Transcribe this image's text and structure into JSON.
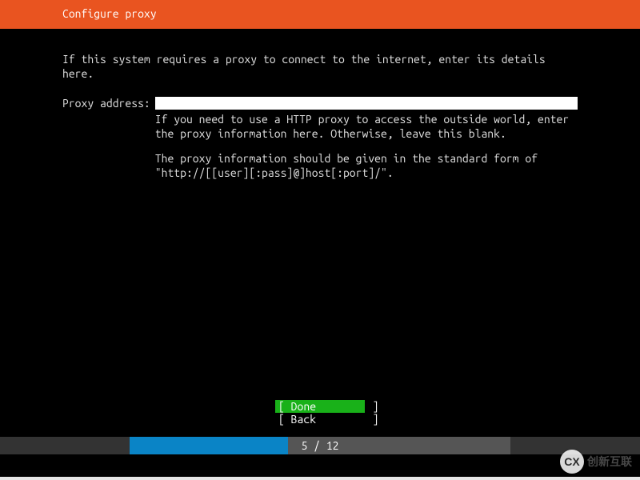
{
  "header": {
    "title": "Configure proxy"
  },
  "content": {
    "instruction": "If this system requires a proxy to connect to the internet, enter its details here.",
    "field_label": "Proxy address:",
    "proxy_value": "",
    "help_line1": "If you need to use a HTTP proxy to access the outside world, enter the proxy information here. Otherwise, leave this blank.",
    "help_line2": "The proxy information should be given in the standard form of \"http://[[user][:pass]@]host[:port]/\"."
  },
  "buttons": {
    "done": "[ Done         ]",
    "back": "[ Back         ]"
  },
  "progress": {
    "current": 5,
    "total": 12,
    "text": "5 / 12",
    "percent": 41.6
  },
  "watermark": {
    "badge": "CX",
    "text": "创新互联"
  }
}
